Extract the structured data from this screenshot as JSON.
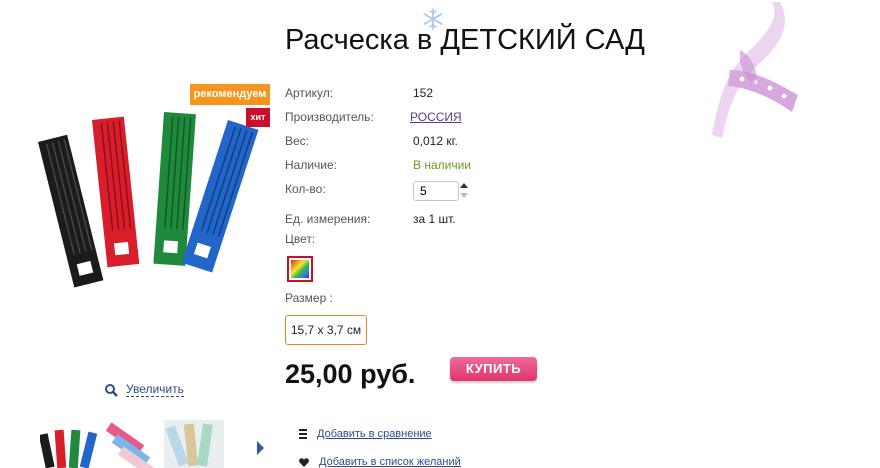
{
  "product": {
    "title": "Расческа в ДЕТСКИЙ САД",
    "badges": {
      "recommend": "рекомендуем",
      "hit": "хит"
    },
    "zoom_label": "Увеличить"
  },
  "props": {
    "article_label": "Артикул:",
    "article_value": "152",
    "maker_label": "Производитель:",
    "maker_value": "РОССИЯ",
    "weight_label": "Вес:",
    "weight_value": "0,012 кг.",
    "availability_label": "Наличие:",
    "availability_value": "В наличии",
    "qty_label": "Кол-во:",
    "qty_value": "5",
    "unit_label": "Ед. измерения:",
    "unit_value": "за 1 шт.",
    "color_label": "Цвет:",
    "size_label": "Размер :",
    "size_option": "15,7 х 3,7 см"
  },
  "purchase": {
    "price": "25,00 руб.",
    "buy_label": "КУПИТЬ"
  },
  "actions": {
    "compare": "Добавить в сравнение",
    "wishlist": "Добавить в список желаний"
  },
  "colors": {
    "accent_orange": "#f7941d",
    "hit_red": "#c8102e",
    "buy_pink": "#e0336e",
    "link_blue": "#2e4b8c",
    "availability_green": "#6a9a1f"
  },
  "icons": [
    "snowflake-icon",
    "ribbon-decoration",
    "magnifier-icon",
    "next-arrow-icon",
    "list-icon",
    "heart-icon"
  ]
}
